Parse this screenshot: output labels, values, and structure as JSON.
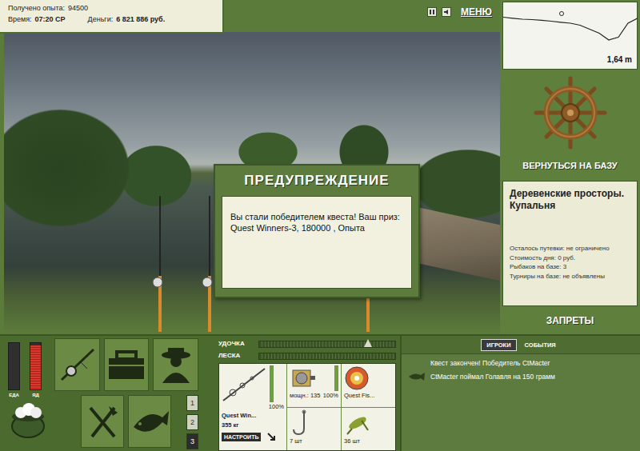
{
  "stats": {
    "experience_label": "Получено опыта:",
    "experience": "94500",
    "time_label": "Время:",
    "time": "07:20 СР",
    "money_label": "Деньги:",
    "money": "6 821 886 руб."
  },
  "toolbar": {
    "menu": "МЕНЮ"
  },
  "depth": {
    "reading": "1,64 m",
    "profile": [
      0.5,
      0.55,
      0.6,
      0.62,
      0.65,
      0.7,
      0.75,
      0.8,
      0.9,
      1.1,
      1.3,
      1.64,
      1.5,
      0.8,
      0.55
    ]
  },
  "dialog": {
    "title": "ПРЕДУПРЕЖДЕНИЕ",
    "message": "Вы стали победителем квеста! Ваш приз: Quest Winners-3, 180000 , Опыта"
  },
  "base": {
    "return_label": "ВЕРНУТЬСЯ НА БАЗУ",
    "location": "Деревенские просторы. Купальня",
    "info": [
      "Осталось путевки: не ограничено",
      "Стоимость дня: 0 руб.",
      "Рыбаков на базе: 3",
      "Турниры на базе: не объявлены"
    ],
    "bans_label": "ЗАПРЕТЫ"
  },
  "needs": [
    {
      "label": "ЕДА",
      "level": 0.0
    },
    {
      "label": "ЯД",
      "level": 0.95
    }
  ],
  "slots": [
    {
      "label": "1",
      "selected": false
    },
    {
      "label": "2",
      "selected": false
    },
    {
      "label": "3",
      "selected": true
    }
  ],
  "gauges": [
    {
      "label": "УДОЧКА",
      "level": 0.0,
      "pointer": 0.8
    },
    {
      "label": "ЛЕСКА",
      "level": 0.0
    }
  ],
  "tackle": {
    "rod": {
      "name": "Quest Win...",
      "weight": "355 кг",
      "level": 1.0,
      "reading": "100%"
    },
    "reel": {
      "power": "мощн.: 135",
      "level": 1.0,
      "reading": "100%"
    },
    "line": {
      "name": "Quest Fis..."
    },
    "hook": {
      "count": "7 шт"
    },
    "bait": {
      "count": "36 шт"
    },
    "setup_button": "НАСТРОИТЬ"
  },
  "chat": {
    "tabs": [
      {
        "label": "ИГРОКИ",
        "selected": true
      },
      {
        "label": "СОБЫТИЯ",
        "selected": false
      }
    ],
    "messages": [
      {
        "text": "Квест закончен! Победитель CtMacter",
        "kind": "system"
      },
      {
        "text": "CtMacter поймал Голавля на 150 грамм",
        "kind": "catch"
      }
    ]
  }
}
